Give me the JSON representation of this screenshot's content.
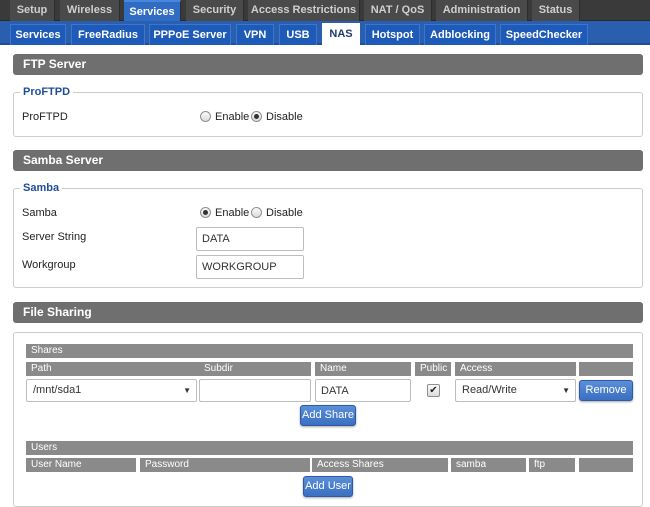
{
  "top_nav": {
    "tabs": [
      "Setup",
      "Wireless",
      "Services",
      "Security",
      "Access Restrictions",
      "NAT / QoS",
      "Administration",
      "Status"
    ],
    "active": "Services"
  },
  "sub_nav": {
    "tabs": [
      "Services",
      "FreeRadius",
      "PPPoE Server",
      "VPN",
      "USB",
      "NAS",
      "Hotspot",
      "Adblocking",
      "SpeedChecker"
    ],
    "active": "NAS"
  },
  "ftp": {
    "title": "FTP Server",
    "legend": "ProFTPD",
    "label": "ProFTPD",
    "enable_label": "Enable",
    "disable_label": "Disable",
    "state": "disable"
  },
  "samba": {
    "title": "Samba Server",
    "legend": "Samba",
    "label": "Samba",
    "enable_label": "Enable",
    "disable_label": "Disable",
    "state": "enable",
    "server_string_label": "Server String",
    "server_string_value": "DATA",
    "workgroup_label": "Workgroup",
    "workgroup_value": "WORKGROUP"
  },
  "file_sharing": {
    "title": "File Sharing",
    "shares": {
      "header": "Shares",
      "columns": [
        "Path",
        "Subdir",
        "Name",
        "Public",
        "Access",
        ""
      ],
      "row": {
        "path": "/mnt/sda1",
        "subdir": "",
        "name": "DATA",
        "public": true,
        "access": "Read/Write",
        "remove_label": "Remove"
      },
      "add_label": "Add Share"
    },
    "users": {
      "header": "Users",
      "columns": [
        "User Name",
        "Password",
        "Access Shares",
        "samba",
        "ftp",
        ""
      ],
      "add_label": "Add User"
    }
  },
  "colors": {
    "accent": "#2f6cc2",
    "section_bar": "#6f6f6f",
    "legend_text": "#1f4c9a"
  }
}
